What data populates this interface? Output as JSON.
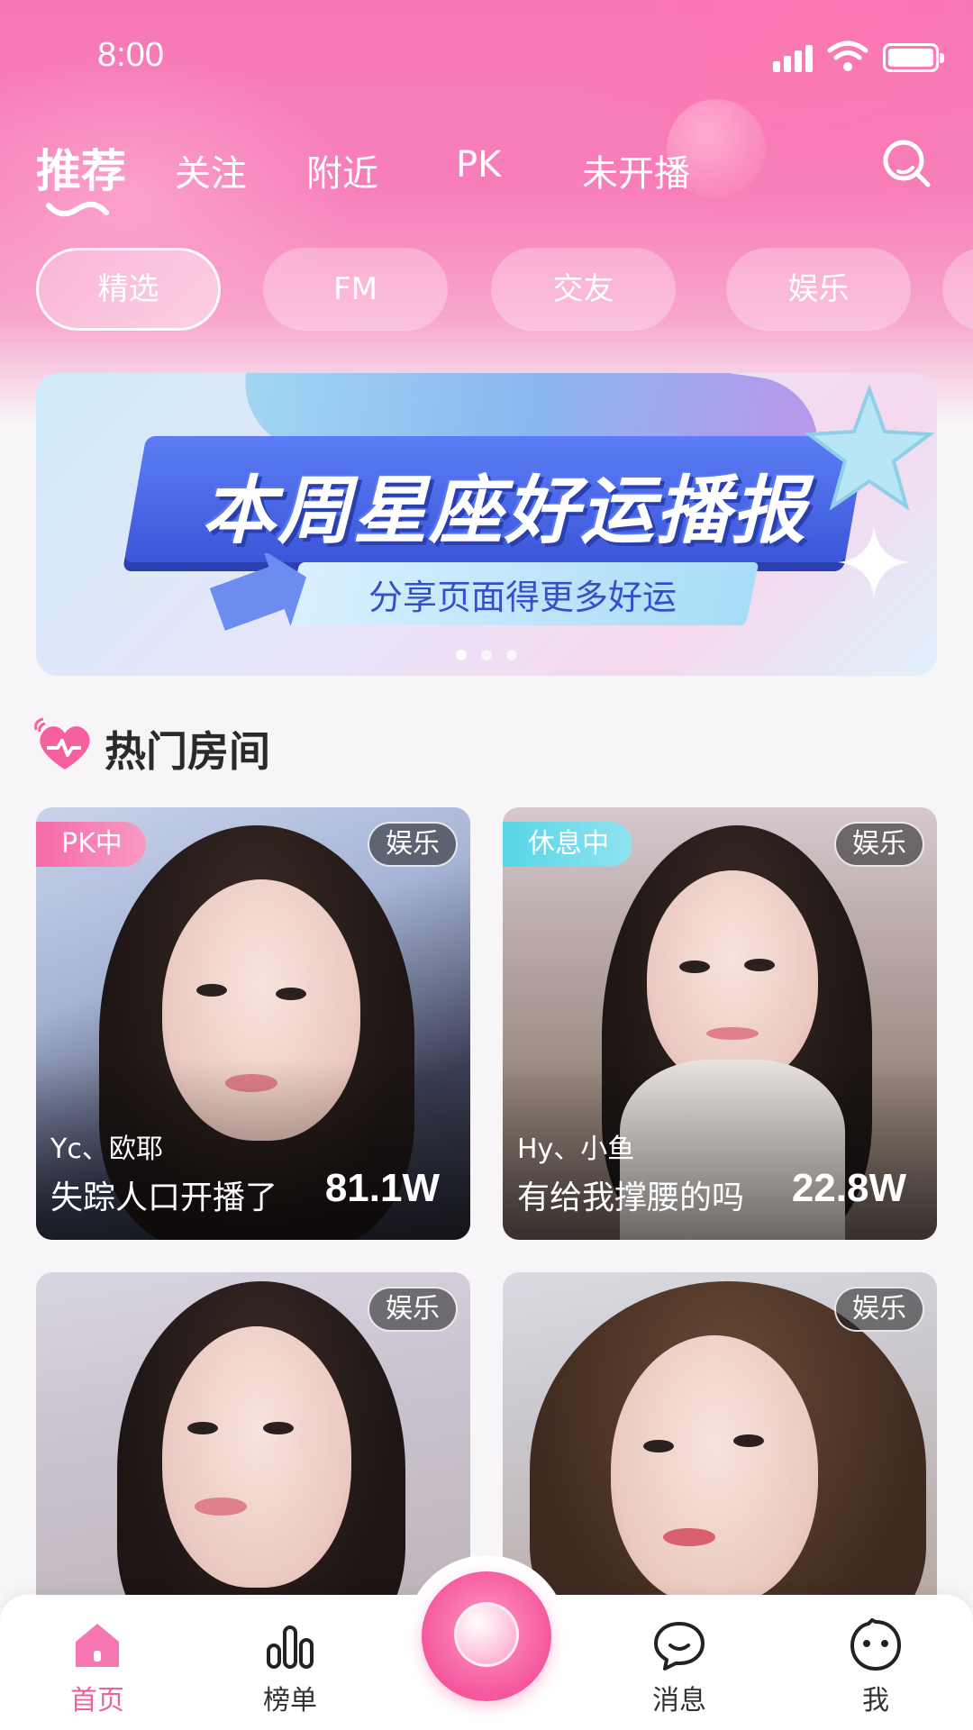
{
  "status_bar": {
    "time": "8:00"
  },
  "top_tabs": [
    {
      "label": "推荐",
      "active": true
    },
    {
      "label": "关注",
      "active": false
    },
    {
      "label": "附近",
      "active": false
    },
    {
      "label": "PK",
      "active": false
    },
    {
      "label": "未开播",
      "active": false
    }
  ],
  "chips": [
    {
      "label": "精选",
      "active": true
    },
    {
      "label": "FM",
      "active": false
    },
    {
      "label": "交友",
      "active": false
    },
    {
      "label": "娱乐",
      "active": false
    }
  ],
  "banner": {
    "title": "本周星座好运播报",
    "subtitle": "分享页面得更多好运",
    "page_count": 3,
    "active_page": 1
  },
  "section": {
    "title": "热门房间"
  },
  "rooms": [
    {
      "status": "PK中",
      "category": "娱乐",
      "host": "Yc、欧耶",
      "title": "失踪人口开播了",
      "viewers": "81.1W"
    },
    {
      "status": "休息中",
      "category": "娱乐",
      "host": "Hy、小鱼",
      "title": "有给我撑腰的吗",
      "viewers": "22.8W"
    },
    {
      "status": "",
      "category": "娱乐",
      "host": "",
      "title": "",
      "viewers": ""
    },
    {
      "status": "",
      "category": "娱乐",
      "host": "",
      "title": "",
      "viewers": ""
    }
  ],
  "bottom_nav": {
    "home": "首页",
    "ranking": "榜单",
    "messages": "消息",
    "profile": "我"
  },
  "colors": {
    "accent_pink": "#f0609f",
    "header_pink": "#f778b6",
    "status_pk": "#f56aa8",
    "status_rest": "#58d5e6"
  }
}
